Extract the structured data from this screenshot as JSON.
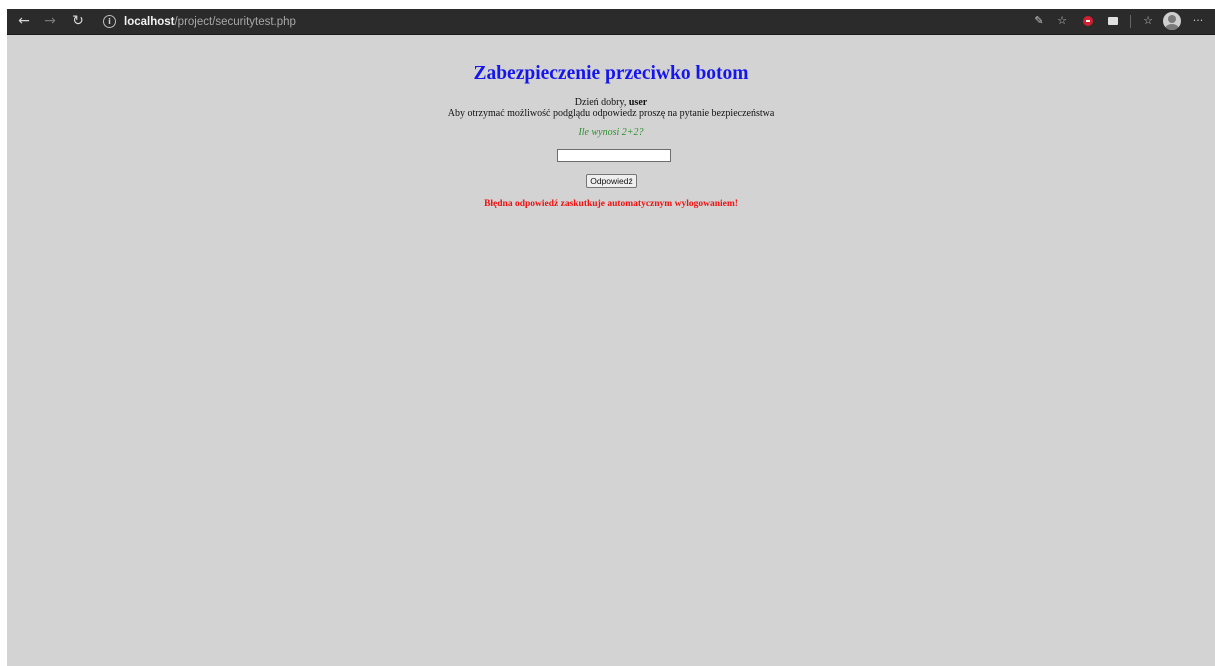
{
  "browser": {
    "url_host": "localhost",
    "url_path": "/project/securitytest.php",
    "toolbar_icons": [
      "read-aloud-icon",
      "favorite-add-icon",
      "extension-red-icon",
      "extension-mail-icon",
      "favorites-icon",
      "profile-icon",
      "more-icon"
    ]
  },
  "page": {
    "title": "Zabezpieczenie przeciwko botom",
    "greeting_prefix": "Dzień dobry, ",
    "username": "user",
    "instruction": "Aby otrzymać możliwość podglądu odpowiedz proszę na pytanie bezpieczeństwa",
    "question": "Ile wynosi 2+2?",
    "answer_value": "",
    "submit_label": "Odpowiedź",
    "warning": "Błędna odpowiedź zaskutkuje automatycznym wylogowaniem!"
  },
  "colors": {
    "page_background": "#d3d3d3",
    "title": "#1515ee",
    "question": "#2f8f2f",
    "warning": "#ee1111"
  }
}
